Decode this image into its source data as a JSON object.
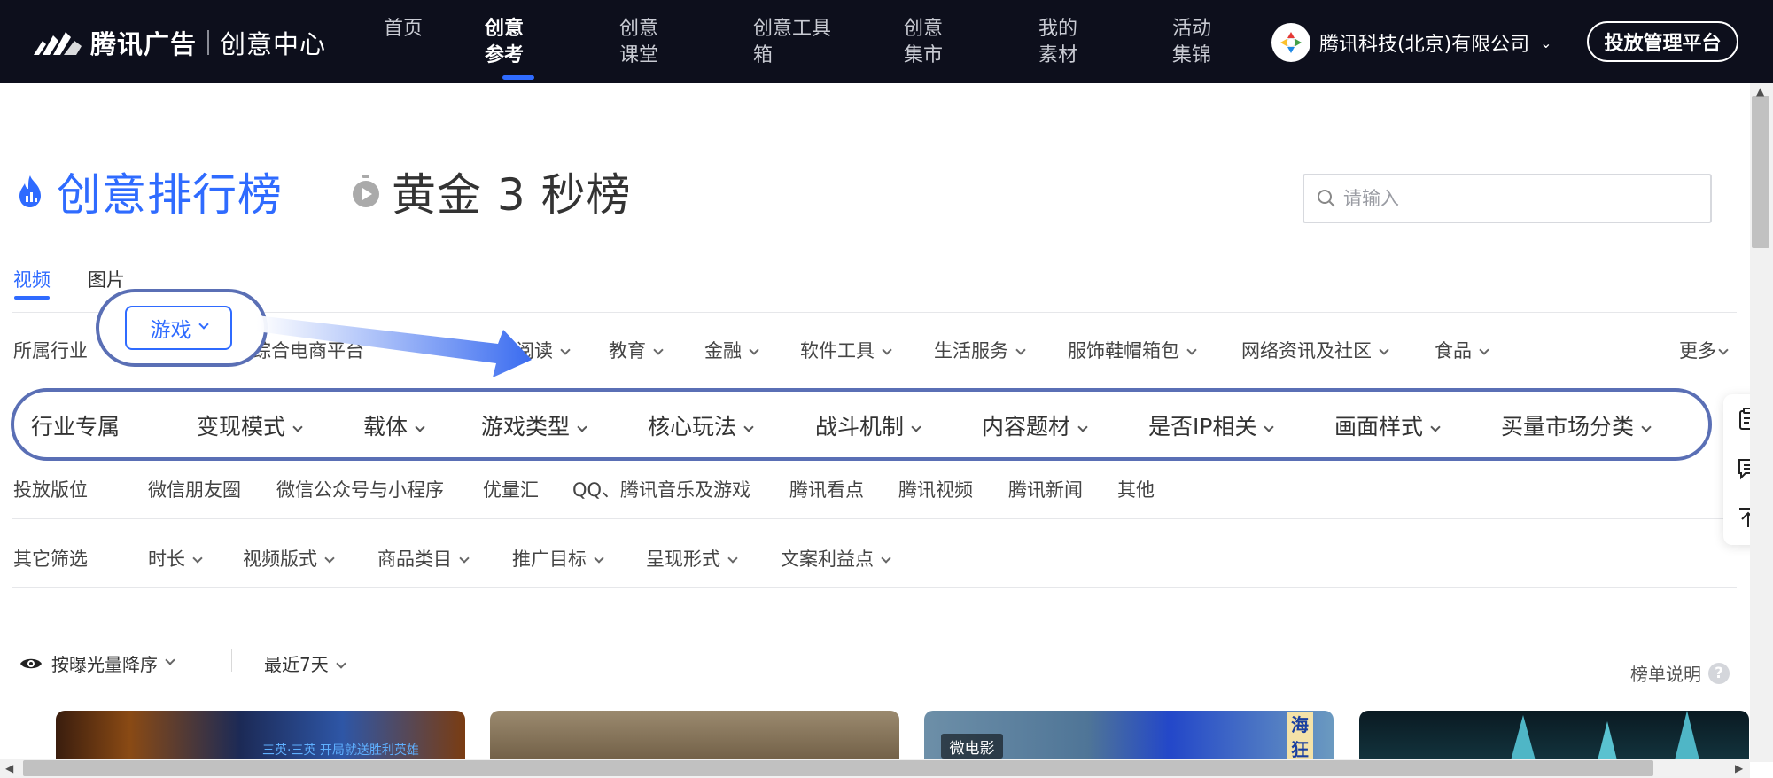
{
  "brand": {
    "name": "腾讯广告",
    "sub": "创意中心"
  },
  "nav": {
    "items": [
      "首页",
      "创意参考",
      "创意课堂",
      "创意工具箱",
      "创意集市",
      "我的素材",
      "活动集锦"
    ],
    "active": "创意参考"
  },
  "company": {
    "name": "腾讯科技(北京)有限公司"
  },
  "buttons": {
    "platform": "投放管理平台"
  },
  "headings": {
    "rank": "创意排行榜",
    "gold": "黄金 3 秒榜"
  },
  "search": {
    "placeholder": "请输入"
  },
  "tabs": [
    "视频",
    "图片"
  ],
  "filters": {
    "industry": {
      "label": "所属行业",
      "selected": "游戏",
      "partial_items": [
        "综合电商平台",
        "阅读"
      ],
      "items": [
        "教育",
        "金融",
        "软件工具",
        "生活服务",
        "服饰鞋帽箱包",
        "网络资讯及社区",
        "食品"
      ],
      "more": "更多"
    },
    "game_sub": [
      "行业专属",
      "变现模式",
      "载体",
      "游戏类型",
      "核心玩法",
      "战斗机制",
      "内容题材",
      "是否IP相关",
      "画面样式",
      "买量市场分类"
    ],
    "placement": {
      "label": "投放版位",
      "items": [
        "微信朋友圈",
        "微信公众号与小程序",
        "优量汇",
        "QQ、腾讯音乐及游戏",
        "腾讯看点",
        "腾讯视频",
        "腾讯新闻",
        "其他"
      ]
    },
    "other": {
      "label": "其它筛选",
      "items": [
        "时长",
        "视频版式",
        "商品类目",
        "推广目标",
        "呈现形式",
        "文案利益点"
      ]
    }
  },
  "sort": {
    "order": "按曝光量降序",
    "range": "最近7天",
    "rank_desc": "榜单说明",
    "help": "?"
  },
  "thumbnails": {
    "tag": "微电影",
    "t1_caption": "三英·三英   开局就送胜利英雄",
    "t3_side": "海狂"
  },
  "colors": {
    "accent": "#2f6bff",
    "nav_bg": "#0d0f1c",
    "highlight": "#5a6fb5"
  }
}
